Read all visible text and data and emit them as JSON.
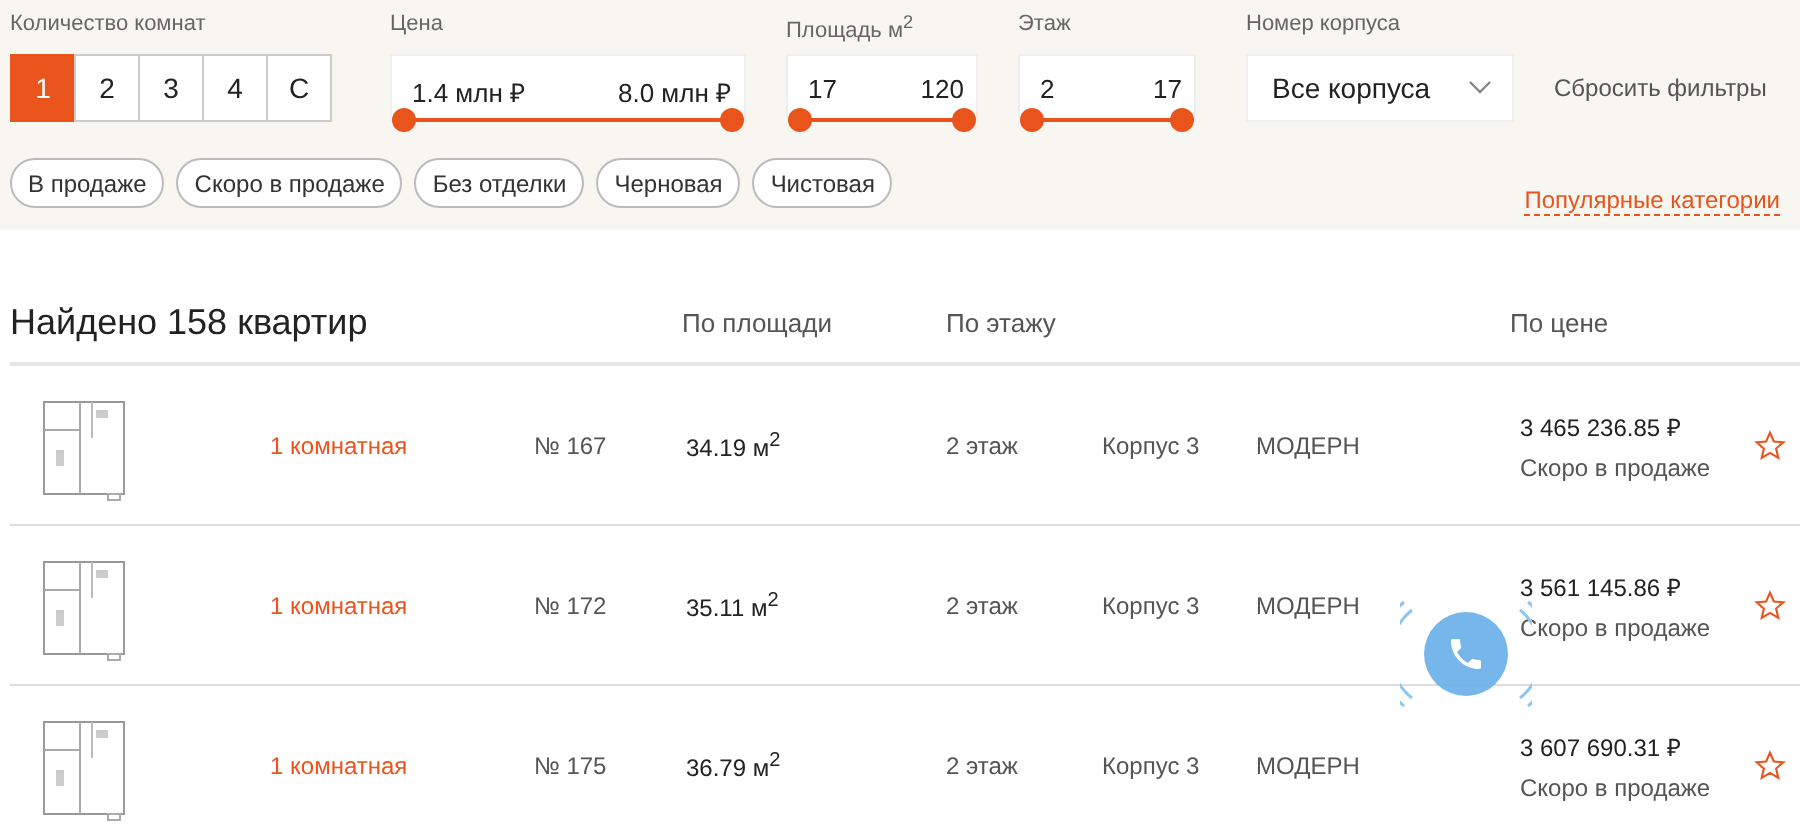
{
  "filters": {
    "rooms": {
      "label": "Количество комнат",
      "options": [
        {
          "label": "1",
          "selected": true
        },
        {
          "label": "2",
          "selected": false
        },
        {
          "label": "3",
          "selected": false
        },
        {
          "label": "4",
          "selected": false
        },
        {
          "label": "С",
          "selected": false
        }
      ]
    },
    "ranges": [
      {
        "label": "Цена",
        "min": "1.4 млн ₽",
        "max": "8.0 млн ₽",
        "level": 1
      },
      {
        "label": "Площадь м$^{2}$",
        "min": "17",
        "max": "120",
        "level": 1
      },
      {
        "label": "Этаж",
        "min": "2",
        "max": "17",
        "level": 1
      }
    ],
    "building": {
      "label": "Номер корпуса",
      "value": "Все корпуса"
    },
    "reset": "Сбросить фильтры",
    "chips": [
      {
        "label": "В продаже",
        "selected": false
      },
      {
        "label": "Скоро в продаже",
        "selected": false
      },
      {
        "label": "Без отделки",
        "selected": false
      },
      {
        "label": "Черновая",
        "selected": false
      },
      {
        "label": "Чистовая",
        "selected": false
      }
    ],
    "popular_link": "Популярные категории"
  },
  "results": {
    "title": "Найдено 158 квартир",
    "sort": [
      "По площади",
      "По этажу",
      "По цене"
    ],
    "rows": [
      {
        "type": "1 комнатная",
        "number": "№ 167",
        "area": "34.19 м$^{2}$",
        "floor": "2 этаж",
        "building": "Корпус 3",
        "style": "МОДЕРН",
        "price": "3 465 236.85 ₽",
        "status": "Скоро в продаже",
        "favorite": false
      },
      {
        "type": "1 комнатная",
        "number": "№ 172",
        "area": "35.11 м$^{2}$",
        "floor": "2 этаж",
        "building": "Корпус 3",
        "style": "МОДЕРН",
        "price": "3 561 145.86 ₽",
        "status": "Скоро в продаже",
        "favorite": false
      },
      {
        "type": "1 комнатная",
        "number": "№ 175",
        "area": "36.79 м$^{2}$",
        "floor": "2 этаж",
        "building": "Корпус 3",
        "style": "МОДЕРН",
        "price": "3 607 690.31 ₽",
        "status": "Скоро в продаже",
        "favorite": false
      }
    ]
  }
}
